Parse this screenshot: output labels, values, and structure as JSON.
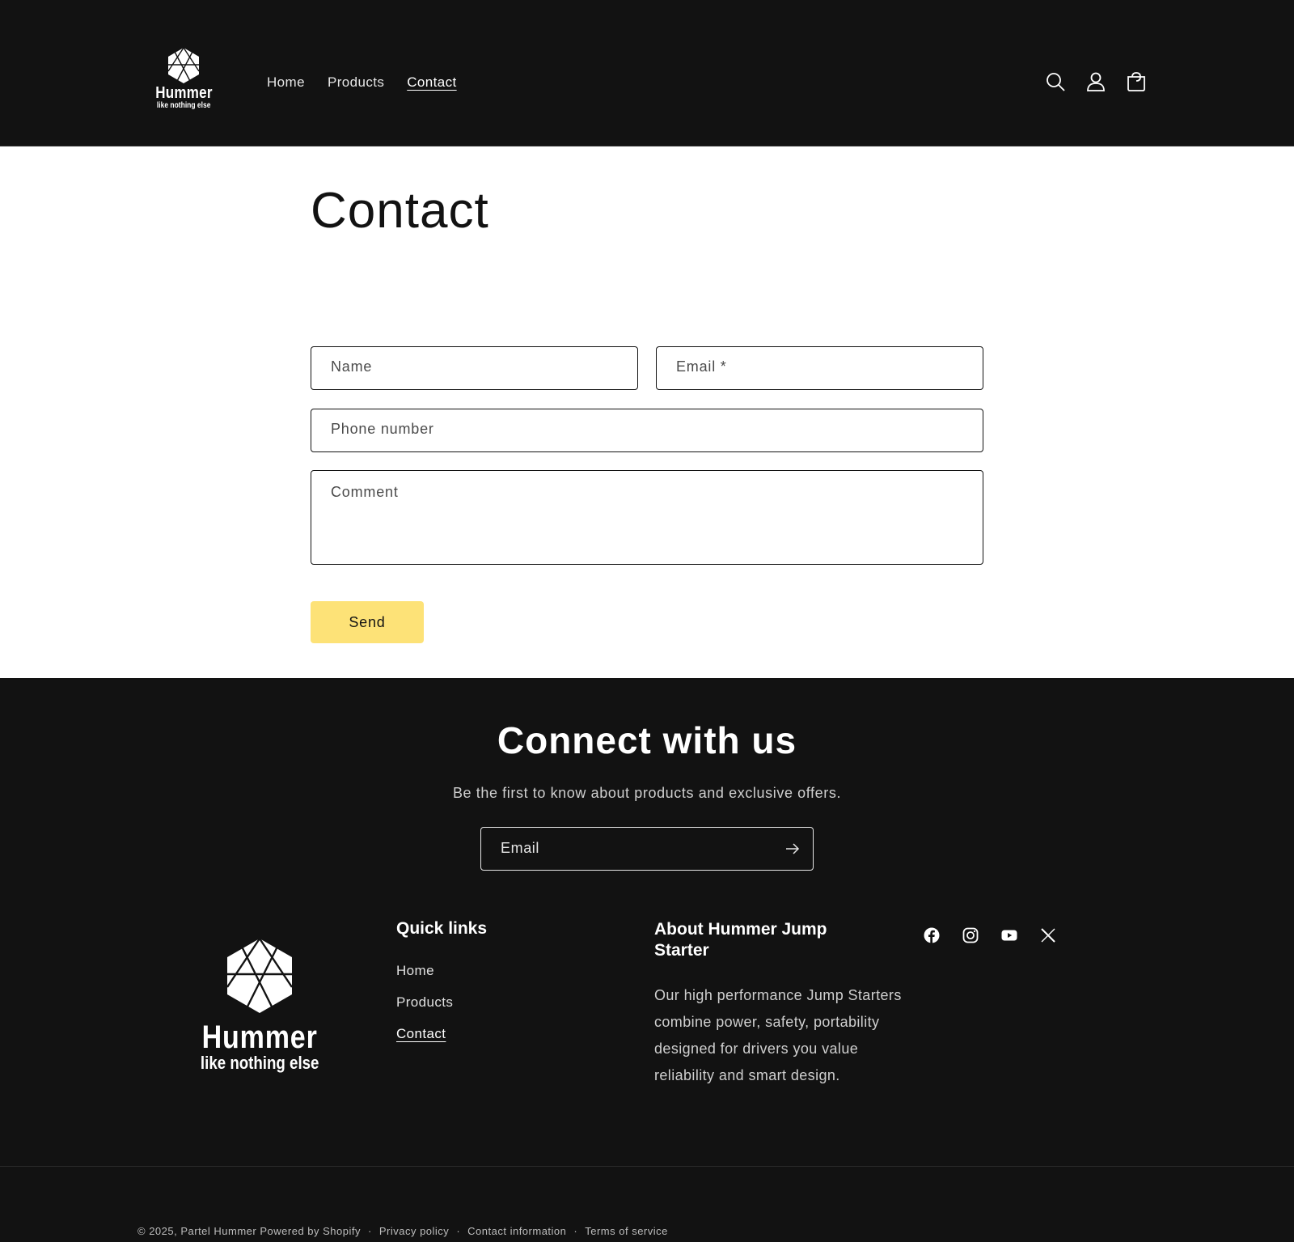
{
  "header": {
    "logo": {
      "brand": "Hummer",
      "tagline": "like nothing else"
    },
    "nav": [
      {
        "label": "Home"
      },
      {
        "label": "Products"
      },
      {
        "label": "Contact"
      }
    ],
    "icons": [
      "search-icon",
      "account-icon",
      "cart-icon"
    ]
  },
  "contact": {
    "title": "Contact",
    "name_placeholder": "Name",
    "email_placeholder": "Email *",
    "phone_placeholder": "Phone number",
    "comment_placeholder": "Comment",
    "send_label": "Send",
    "accent_color": "#fde277"
  },
  "newsletter": {
    "title": "Connect with us",
    "subtitle": "Be the first to know about products and exclusive offers.",
    "email_placeholder": "Email"
  },
  "footer": {
    "logo": {
      "brand": "Hummer",
      "tagline": "like nothing else"
    },
    "quick_links": {
      "title": "Quick links",
      "items": [
        {
          "label": "Home"
        },
        {
          "label": "Products"
        },
        {
          "label": "Contact"
        }
      ]
    },
    "about": {
      "title": "About Hummer Jump Starter",
      "text": "Our high performance Jump Starters combine power, safety, portability designed for drivers you value reliability and smart design."
    },
    "social": [
      "facebook-icon",
      "instagram-icon",
      "youtube-icon",
      "x-icon"
    ],
    "bottom": {
      "copyright": "© 2025, Partel Hummer",
      "powered": "Powered by Shopify",
      "separator": "·",
      "links": [
        {
          "label": "Privacy policy"
        },
        {
          "label": "Contact information"
        },
        {
          "label": "Terms of service"
        }
      ]
    }
  },
  "colors": {
    "background_dark": "#121212",
    "background_light": "#ffffff"
  }
}
